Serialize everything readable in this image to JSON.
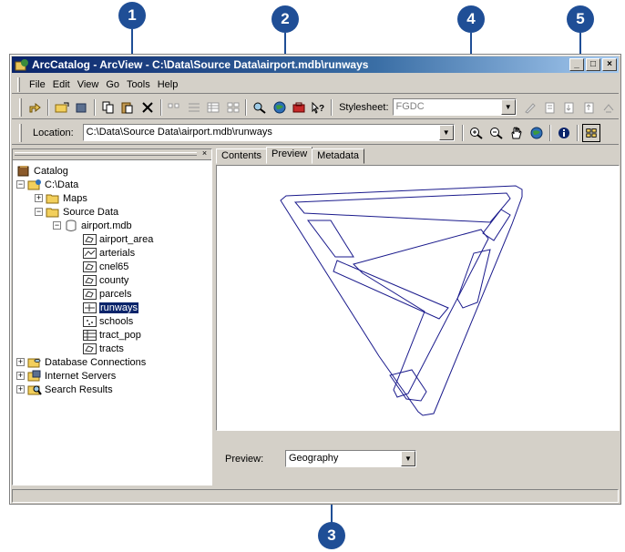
{
  "callouts": [
    "1",
    "2",
    "3",
    "4",
    "5"
  ],
  "window": {
    "title": "ArcCatalog - ArcView - C:\\Data\\Source Data\\airport.mdb\\runways",
    "buttons": [
      "_",
      "□",
      "×"
    ]
  },
  "menu": [
    "File",
    "Edit",
    "View",
    "Go",
    "Tools",
    "Help"
  ],
  "toolbar": {
    "stylesheet_label": "Stylesheet:",
    "stylesheet_value": "FGDC"
  },
  "location": {
    "label": "Location:",
    "value": "C:\\Data\\Source Data\\airport.mdb\\runways"
  },
  "tree": {
    "root": "Catalog",
    "drive": "C:\\Data",
    "maps": "Maps",
    "source_data": "Source Data",
    "database": "airport.mdb",
    "layers": [
      "airport_area",
      "arterials",
      "cnel65",
      "county",
      "parcels",
      "runways",
      "schools",
      "tract_pop",
      "tracts"
    ],
    "selected": "runways",
    "other": [
      "Database Connections",
      "Internet Servers",
      "Search Results"
    ]
  },
  "tabs": [
    "Contents",
    "Preview",
    "Metadata"
  ],
  "active_tab": "Preview",
  "preview": {
    "label": "Preview:",
    "value": "Geography"
  },
  "colors": {
    "callout": "#1f4e96",
    "title_bar": "#0a246a",
    "runway_line": "#1a1a8c"
  }
}
